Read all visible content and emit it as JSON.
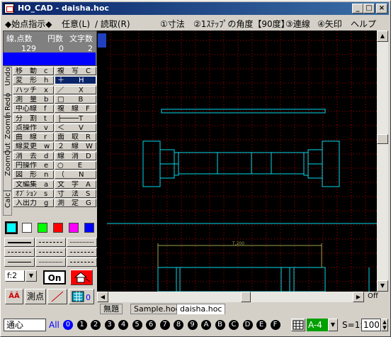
{
  "window": {
    "title": "HO_CAD - daisha.hoc",
    "min": "_",
    "max": "□",
    "close": "×"
  },
  "menu": {
    "mode": "◆始点指示◆",
    "options": "任意(L)",
    "read": "/ 読取(R)",
    "item1": "①寸法",
    "item2": "②1ｽﾃｯﾌﾟの角度【90度】",
    "item3": "③連線",
    "item4": "④矢印",
    "help": "ヘルプ"
  },
  "stats": {
    "labels": [
      "線,点数",
      "円数",
      "文字数"
    ],
    "values": [
      "129",
      "0",
      "2"
    ]
  },
  "vtabs": [
    "Undo",
    "Redo",
    "ZoomIn",
    "ZoomOut",
    "Calc"
  ],
  "commands": [
    [
      "移　動　c",
      "複　写　C"
    ],
    [
      "変　形　h",
      "＋　　H"
    ],
    [
      "ハッチ　x",
      "／　　X"
    ],
    [
      "測　量　b",
      "□　　B"
    ],
    [
      "中心線　f",
      "複　線　F"
    ],
    [
      "分　割　t",
      "├────T"
    ],
    [
      "点操作　v",
      "＜　　V"
    ],
    [
      "曲　線　r",
      "面　取　R"
    ],
    [
      "線変更　w",
      "２　線　W"
    ],
    [
      "消　去　d",
      "線　消　D"
    ],
    [
      "円操作　e",
      "○　　E"
    ],
    [
      "図　形　n",
      "（　　N"
    ],
    [
      "文編集　a",
      "文　字　A"
    ],
    [
      "ｵﾌﾟｼｮﾝ　s",
      "寸　法　S"
    ],
    [
      "入出力　g",
      "測　定　G"
    ]
  ],
  "colors": [
    "#00ffff",
    "#ffffff",
    "#00ff00",
    "#ff0000",
    "#ff00ff",
    "#0000ff"
  ],
  "font_select": "f:2",
  "on_button": "On",
  "aa_button": "ÂÂ",
  "point_button": "測点",
  "canvas_dim_text": "T,200",
  "tabs": [
    "無題",
    "Sample.hoc",
    "daisha.hoc"
  ],
  "off_label": "Off",
  "status": {
    "mode": "通心",
    "all": "All",
    "layers": [
      "0",
      "1",
      "2",
      "3",
      "4",
      "5",
      "6",
      "7",
      "8",
      "9",
      "A",
      "B",
      "C",
      "D",
      "E",
      "F"
    ],
    "paper": "A-4",
    "scale_label": "S=1:",
    "scale_value": "100"
  }
}
